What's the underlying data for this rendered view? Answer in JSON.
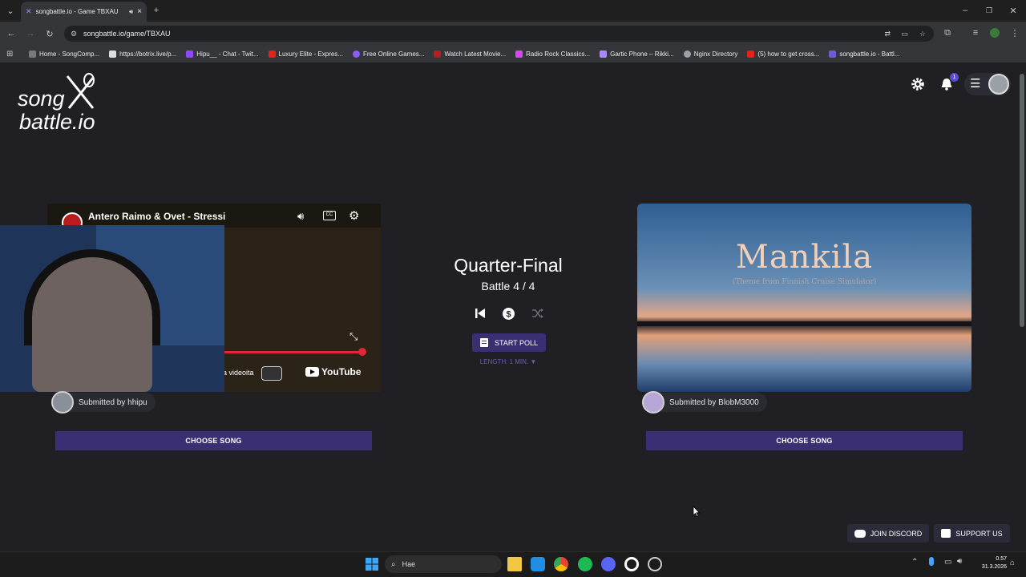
{
  "browser": {
    "tab_title": "songbattle.io - Game TBXAU",
    "url": "songbattle.io/game/TBXAU",
    "bookmarks": [
      "Home - SongComp...",
      "https://botrix.live/p...",
      "Hipu__ - Chat - Twit...",
      "Luxury Elite - Expres...",
      "Free Online Games...",
      "Watch Latest Movie...",
      "Radio Rock Classics...",
      "Gartic Phone – Rikki...",
      "Nginx Directory",
      "(5) how to get cross...",
      "songbattle.io - Battl..."
    ]
  },
  "site": {
    "logo_line1": "song",
    "logo_line2": "battle.io",
    "notification_count": "1"
  },
  "left": {
    "video_title": "Antero Raimo & Ovet - Stressi",
    "overlay_text": "a videoita",
    "youtube_label": "YouTube",
    "submitted_by": "Submitted by hhipu",
    "choose_label": "CHOOSE SONG"
  },
  "right": {
    "thumb_title": "Mankila",
    "thumb_subtitle": "(Theme from Finnish Cruise Simulator)",
    "submitted_by": "Submitted by BlobM3000",
    "choose_label": "CHOOSE SONG"
  },
  "center": {
    "round": "Quarter-Final",
    "battle": "Battle 4 / 4",
    "start_poll": "START POLL",
    "length": "LENGTH: 1 MIN. ▼"
  },
  "footer": {
    "discord": "JOIN DISCORD",
    "support": "SUPPORT US"
  },
  "taskbar": {
    "search_placeholder": "Hae",
    "time": "0.57",
    "date": "31.3.2026"
  },
  "colors": {
    "accent": "#3a2f73",
    "background": "#1f1f24"
  }
}
